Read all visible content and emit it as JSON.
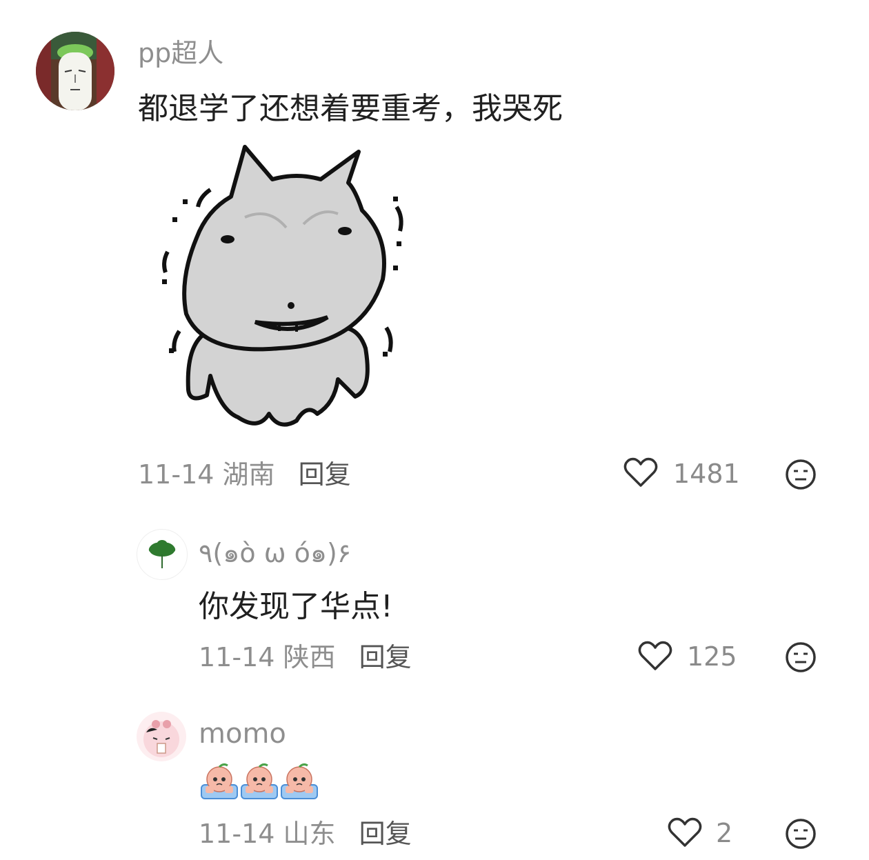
{
  "comments": [
    {
      "username": "pp超人",
      "text": "都退学了还想着要重考，我哭死",
      "sticker": "grumpy-cat-sticker",
      "date": "11-14",
      "region": "湖南",
      "reply_label": "回复",
      "like_count": "1481",
      "icons": {
        "like": "heart-outline-icon",
        "dislike": "meh-face-icon"
      }
    },
    {
      "username": "٩(๑ò ω ó๑)۶",
      "text": "你发现了华点!",
      "date": "11-14",
      "region": "陕西",
      "reply_label": "回复",
      "like_count": "125",
      "icons": {
        "like": "heart-outline-icon",
        "dislike": "meh-face-icon"
      }
    },
    {
      "username": "momo",
      "emojis": [
        "crying-peach-emoji",
        "crying-peach-emoji",
        "crying-peach-emoji"
      ],
      "date": "11-14",
      "region": "山东",
      "reply_label": "回复",
      "like_count": "2",
      "icons": {
        "like": "heart-outline-icon",
        "dislike": "meh-face-icon"
      }
    }
  ],
  "colors": {
    "meta_text": "#8e8e8e",
    "body_text": "#202020",
    "sticker_fill": "#d3d3d3"
  }
}
